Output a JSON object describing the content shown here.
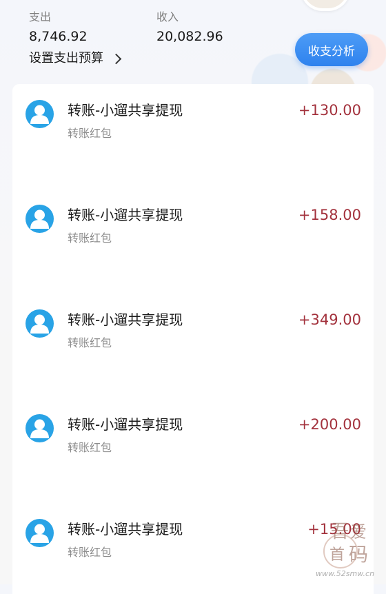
{
  "summary": {
    "expense_label": "支出",
    "expense_value": "8,746.92",
    "income_label": "收入",
    "income_value": "20,082.96",
    "budget_link": "设置支出预算",
    "analysis_button": "收支分析"
  },
  "transactions": [
    {
      "title": "转账-小遛共享提现",
      "subtitle": "转账红包",
      "amount": "+130.00"
    },
    {
      "title": "转账-小遛共享提现",
      "subtitle": "转账红包",
      "amount": "+158.00"
    },
    {
      "title": "转账-小遛共享提现",
      "subtitle": "转账红包",
      "amount": "+349.00"
    },
    {
      "title": "转账-小遛共享提现",
      "subtitle": "转账红包",
      "amount": "+200.00"
    },
    {
      "title": "转账-小遛共享提现",
      "subtitle": "转账红包",
      "amount": "+15.00"
    }
  ],
  "watermark": {
    "site": "www.52smw.cn",
    "stamp_chars": "吾爱首码"
  },
  "colors": {
    "accent_blue": "#2e82ee",
    "avatar_blue": "#29a3e6",
    "amount_red": "#a3323d"
  },
  "icons": {
    "user_avatar": "user-avatar-icon",
    "chevron": "chevron-right-icon"
  }
}
